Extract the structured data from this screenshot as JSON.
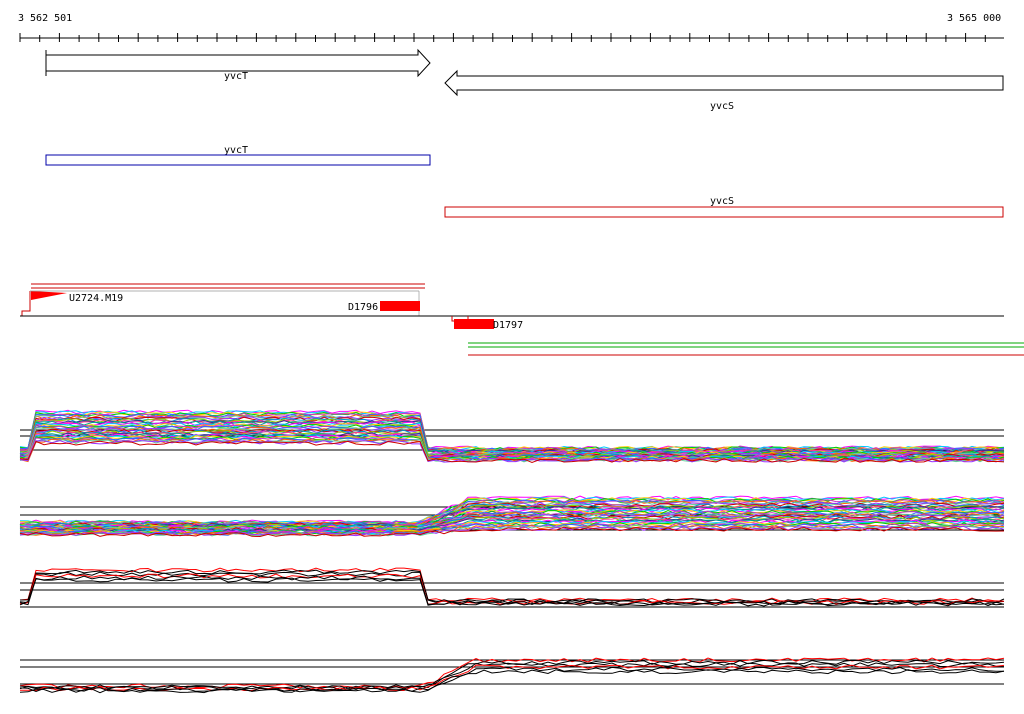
{
  "coordinates": {
    "start": "3 562 501",
    "end": "3 565 000"
  },
  "genes": {
    "top_strand": {
      "name": "yvcT",
      "color": "#000000"
    },
    "bottom_strand": {
      "name": "yvcS",
      "color": "#000000"
    }
  },
  "annotations": {
    "forward": {
      "name": "yvcT",
      "color": "#0000aa"
    },
    "reverse": {
      "name": "yvcS",
      "color": "#cc0000"
    }
  },
  "features": {
    "transcript_label": "U2724.M19",
    "feature_a": "D1796",
    "feature_b": "D1797",
    "feature_color": "#ff0000"
  },
  "colors": {
    "axis": "#000000",
    "highlight_red": "#ff0000",
    "highlight_green": "#00aa00"
  }
}
